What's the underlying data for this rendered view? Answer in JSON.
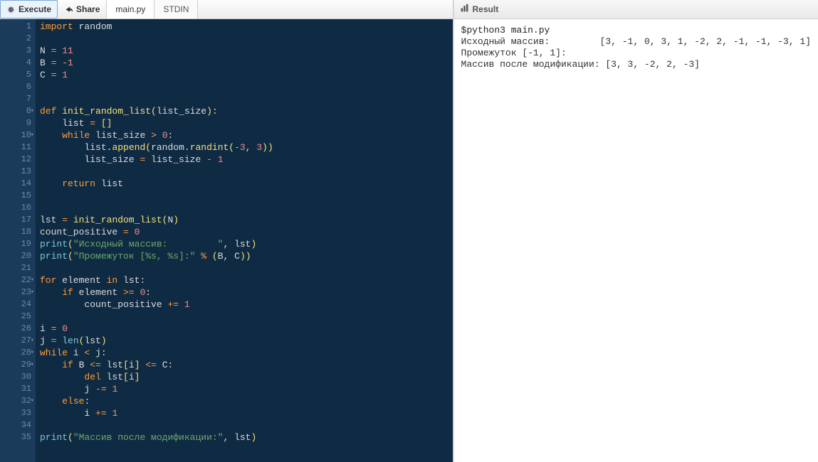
{
  "toolbar": {
    "execute_label": "Execute",
    "share_label": "Share"
  },
  "tabs": [
    {
      "label": "main.py",
      "active": true
    },
    {
      "label": "STDIN",
      "active": false
    }
  ],
  "result": {
    "title": "Result",
    "command": "$python3 main.py",
    "lines": [
      "Исходный массив:         [3, -1, 0, 3, 1, -2, 2, -1, -1, -3, 1]",
      "Промежуток [-1, 1]:",
      "Массив после модификации: [3, 3, -2, 2, -3]"
    ]
  },
  "gutter": {
    "lines": 35,
    "folds": [
      8,
      10,
      22,
      23,
      27,
      28,
      29,
      32
    ]
  },
  "code_lines": [
    [
      [
        "kw",
        "import"
      ],
      [
        "id",
        " random"
      ]
    ],
    [],
    [
      [
        "id",
        "N "
      ],
      [
        "op",
        "="
      ],
      [
        "id",
        " "
      ],
      [
        "num",
        "11"
      ]
    ],
    [
      [
        "id",
        "B "
      ],
      [
        "op",
        "="
      ],
      [
        "id",
        " "
      ],
      [
        "op",
        "-"
      ],
      [
        "num",
        "1"
      ]
    ],
    [
      [
        "id",
        "C "
      ],
      [
        "op",
        "="
      ],
      [
        "id",
        " "
      ],
      [
        "num",
        "1"
      ]
    ],
    [],
    [],
    [
      [
        "kw",
        "def"
      ],
      [
        "id",
        " "
      ],
      [
        "fn",
        "init_random_list"
      ],
      [
        "paren",
        "("
      ],
      [
        "id",
        "list_size"
      ],
      [
        "paren",
        ")"
      ],
      [
        "punc",
        ":"
      ]
    ],
    [
      [
        "id",
        "    list "
      ],
      [
        "op",
        "="
      ],
      [
        "id",
        " "
      ],
      [
        "paren",
        "["
      ],
      [
        "paren",
        "]"
      ]
    ],
    [
      [
        "id",
        "    "
      ],
      [
        "kw",
        "while"
      ],
      [
        "id",
        " list_size "
      ],
      [
        "op",
        ">"
      ],
      [
        "id",
        " "
      ],
      [
        "num",
        "0"
      ],
      [
        "punc",
        ":"
      ]
    ],
    [
      [
        "id",
        "        list"
      ],
      [
        "punc",
        "."
      ],
      [
        "fn",
        "append"
      ],
      [
        "paren",
        "("
      ],
      [
        "id",
        "random"
      ],
      [
        "punc",
        "."
      ],
      [
        "fn",
        "randint"
      ],
      [
        "paren",
        "("
      ],
      [
        "op",
        "-"
      ],
      [
        "num",
        "3"
      ],
      [
        "punc",
        ", "
      ],
      [
        "num",
        "3"
      ],
      [
        "paren",
        ")"
      ],
      [
        "paren",
        ")"
      ]
    ],
    [
      [
        "id",
        "        list_size "
      ],
      [
        "op",
        "="
      ],
      [
        "id",
        " list_size "
      ],
      [
        "op",
        "-"
      ],
      [
        "id",
        " "
      ],
      [
        "num",
        "1"
      ]
    ],
    [],
    [
      [
        "id",
        "    "
      ],
      [
        "kw",
        "return"
      ],
      [
        "id",
        " list"
      ]
    ],
    [],
    [],
    [
      [
        "id",
        "lst "
      ],
      [
        "op",
        "="
      ],
      [
        "id",
        " "
      ],
      [
        "fn",
        "init_random_list"
      ],
      [
        "paren",
        "("
      ],
      [
        "id",
        "N"
      ],
      [
        "paren",
        ")"
      ]
    ],
    [
      [
        "id",
        "count_positive "
      ],
      [
        "op",
        "="
      ],
      [
        "id",
        " "
      ],
      [
        "num",
        "0"
      ]
    ],
    [
      [
        "builtin",
        "print"
      ],
      [
        "paren",
        "("
      ],
      [
        "str",
        "\"Исходный массив:         \""
      ],
      [
        "punc",
        ", "
      ],
      [
        "id",
        "lst"
      ],
      [
        "paren",
        ")"
      ]
    ],
    [
      [
        "builtin",
        "print"
      ],
      [
        "paren",
        "("
      ],
      [
        "str",
        "\"Промежуток [%s, %s]:\""
      ],
      [
        "id",
        " "
      ],
      [
        "op",
        "%"
      ],
      [
        "id",
        " "
      ],
      [
        "paren",
        "("
      ],
      [
        "id",
        "B"
      ],
      [
        "punc",
        ", "
      ],
      [
        "id",
        "C"
      ],
      [
        "paren",
        ")"
      ],
      [
        "paren",
        ")"
      ]
    ],
    [],
    [
      [
        "kw",
        "for"
      ],
      [
        "id",
        " element "
      ],
      [
        "kw",
        "in"
      ],
      [
        "id",
        " lst"
      ],
      [
        "punc",
        ":"
      ]
    ],
    [
      [
        "id",
        "    "
      ],
      [
        "kw",
        "if"
      ],
      [
        "id",
        " element "
      ],
      [
        "op",
        ">="
      ],
      [
        "id",
        " "
      ],
      [
        "num",
        "0"
      ],
      [
        "punc",
        ":"
      ]
    ],
    [
      [
        "id",
        "        count_positive "
      ],
      [
        "op",
        "+="
      ],
      [
        "id",
        " "
      ],
      [
        "num",
        "1"
      ]
    ],
    [],
    [
      [
        "id",
        "i "
      ],
      [
        "op",
        "="
      ],
      [
        "id",
        " "
      ],
      [
        "num",
        "0"
      ]
    ],
    [
      [
        "id",
        "j "
      ],
      [
        "op",
        "="
      ],
      [
        "id",
        " "
      ],
      [
        "builtin",
        "len"
      ],
      [
        "paren",
        "("
      ],
      [
        "id",
        "lst"
      ],
      [
        "paren",
        ")"
      ]
    ],
    [
      [
        "kw",
        "while"
      ],
      [
        "id",
        " i "
      ],
      [
        "op",
        "<"
      ],
      [
        "id",
        " j"
      ],
      [
        "punc",
        ":"
      ]
    ],
    [
      [
        "id",
        "    "
      ],
      [
        "kw",
        "if"
      ],
      [
        "id",
        " B "
      ],
      [
        "op",
        "<="
      ],
      [
        "id",
        " lst"
      ],
      [
        "paren",
        "["
      ],
      [
        "id",
        "i"
      ],
      [
        "paren",
        "]"
      ],
      [
        "id",
        " "
      ],
      [
        "op",
        "<="
      ],
      [
        "id",
        " C"
      ],
      [
        "punc",
        ":"
      ]
    ],
    [
      [
        "id",
        "        "
      ],
      [
        "kw",
        "del"
      ],
      [
        "id",
        " lst"
      ],
      [
        "paren",
        "["
      ],
      [
        "id",
        "i"
      ],
      [
        "paren",
        "]"
      ]
    ],
    [
      [
        "id",
        "        j "
      ],
      [
        "op",
        "-="
      ],
      [
        "id",
        " "
      ],
      [
        "num",
        "1"
      ]
    ],
    [
      [
        "id",
        "    "
      ],
      [
        "kw",
        "else"
      ],
      [
        "punc",
        ":"
      ]
    ],
    [
      [
        "id",
        "        i "
      ],
      [
        "op",
        "+="
      ],
      [
        "id",
        " "
      ],
      [
        "num",
        "1"
      ]
    ],
    [],
    [
      [
        "builtin",
        "print"
      ],
      [
        "paren",
        "("
      ],
      [
        "str",
        "\"Массив после модификации:\""
      ],
      [
        "punc",
        ", "
      ],
      [
        "id",
        "lst"
      ],
      [
        "paren",
        ")"
      ]
    ]
  ]
}
